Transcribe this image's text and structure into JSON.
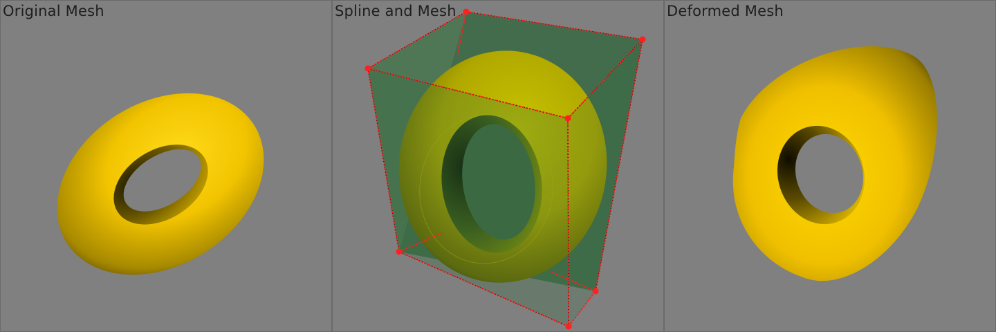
{
  "viewports": [
    {
      "title": "Original Mesh"
    },
    {
      "title": "Spline and Mesh"
    },
    {
      "title": "Deformed Mesh"
    }
  ],
  "colors": {
    "background": "#808080",
    "mesh_light": "#ffd700",
    "mesh_dark": "#2a2400",
    "spline_face": "#2e6b3a",
    "spline_edge": "#ff2020",
    "control_point": "#ff2020"
  },
  "icons": [
    "torus-mesh",
    "spline-cage",
    "control-point"
  ]
}
